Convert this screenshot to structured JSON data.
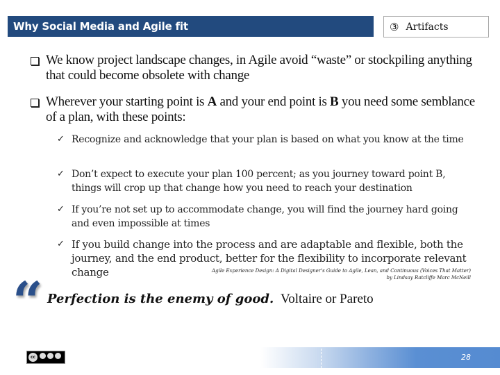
{
  "header": {
    "title": "Why Social Media and Agile fit",
    "section_number": "③",
    "section_label": "Artifacts"
  },
  "bullets": [
    {
      "icon": "checkbox-square-icon",
      "text": "We know project landscape changes, in Agile avoid “waste” or stockpiling anything that could become obsolete with change"
    },
    {
      "icon": "checkbox-square-icon",
      "text_before_a": "Wherever your starting point is ",
      "a": "A",
      "text_between": " and your end point is ",
      "b": "B",
      "text_after_b": " you need some semblance of a plan, with these points:"
    }
  ],
  "checks": [
    {
      "mark": "✓",
      "text": "Recognize and acknowledge that your plan is based on what you know at the time"
    },
    {
      "mark": "✓",
      "text": "Don’t expect to execute your plan 100 percent; as you journey toward point B, things will crop up that change how you need to reach your destination"
    },
    {
      "mark": "✓",
      "text": " If you’re not set up to accommodate change, you will find the journey hard going and even impossible at times"
    },
    {
      "mark": "✓",
      "text": "If you build change into the process and are adaptable and flexible, both the journey, and the end product, better for the flexibility to incorporate relevant change"
    }
  ],
  "citation": {
    "line1": "Agile Experience Design: A Digital Designer's Guide to Agile, Lean, and Continuous (Voices That Matter)",
    "line2": "by Lindsay Ratcliffe Marc McNeill"
  },
  "quote": {
    "mark": "“",
    "text": "Perfection is the enemy of good.",
    "author": "Voltaire or Pareto"
  },
  "footer": {
    "license": "cc",
    "license_terms": [
      "BY",
      "NC",
      "SA"
    ],
    "page_number": "28"
  },
  "colors": {
    "title_bar": "#224a7e",
    "footer_bar": "#558bd1",
    "quote_mark": "#2a4f8a"
  }
}
